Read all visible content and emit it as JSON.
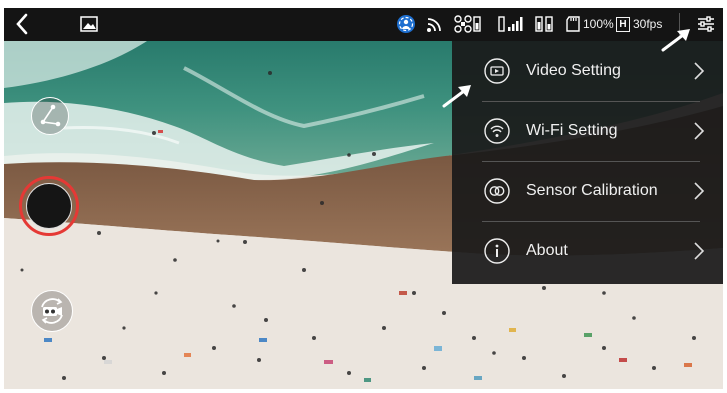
{
  "status_bar": {
    "back_icon": "chevron-left-icon",
    "gallery_icon": "image-icon",
    "battery_percent": "100%",
    "resolution_badge": "H",
    "frame_rate": "30fps",
    "settings_icon": "sliders-icon"
  },
  "left_controls": {
    "path_icon": "waypoint-path-icon",
    "record_icon": "record-icon",
    "switch_icon": "camera-switch-icon"
  },
  "menu": {
    "items": [
      {
        "label": "Video Setting",
        "icon": "video-icon"
      },
      {
        "label": "Wi-Fi Setting",
        "icon": "wifi-icon"
      },
      {
        "label": "Sensor Calibration",
        "icon": "calibration-icon"
      },
      {
        "label": "About",
        "icon": "info-icon"
      }
    ]
  },
  "colors": {
    "status_bar": "#141414",
    "menu_bg": "#1a1a1a",
    "record_ring": "#e53935",
    "gps_icon": "#1e6fd0"
  }
}
